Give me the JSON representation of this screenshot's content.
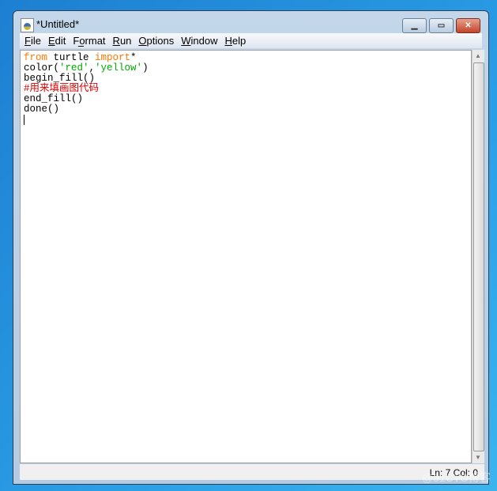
{
  "window": {
    "title": "*Untitled*",
    "minimize_icon": "minimize-icon",
    "maximize_icon": "maximize-icon",
    "close_icon": "close-icon"
  },
  "menu": [
    {
      "label": "File",
      "u": "F",
      "rest": "ile"
    },
    {
      "label": "Edit",
      "u": "E",
      "rest": "dit"
    },
    {
      "pre": "F",
      "u": "o",
      "rest": "rmat",
      "label": "Format"
    },
    {
      "label": "Run",
      "u": "R",
      "rest": "un"
    },
    {
      "label": "Options",
      "u": "O",
      "rest": "ptions"
    },
    {
      "label": "Window",
      "u": "W",
      "rest": "indow"
    },
    {
      "label": "Help",
      "u": "H",
      "rest": "elp"
    }
  ],
  "code": {
    "l1_kw1": "from",
    "l1_mid": " turtle ",
    "l1_kw2": "import",
    "l1_end": "*",
    "l2_a": "color(",
    "l2_s1": "'red'",
    "l2_b": ",",
    "l2_s2": "'yellow'",
    "l2_c": ")",
    "l3": "begin_fill()",
    "l4": "#用来填画图代码",
    "l5": "end_fill()",
    "l6": "done()"
  },
  "status": {
    "line_col": "Ln: 7   Col: 0"
  },
  "watermark": "@51CTO博客",
  "colors": {
    "keyword": "#ff7700",
    "string": "#00aa00",
    "comment": "#dd0000"
  }
}
